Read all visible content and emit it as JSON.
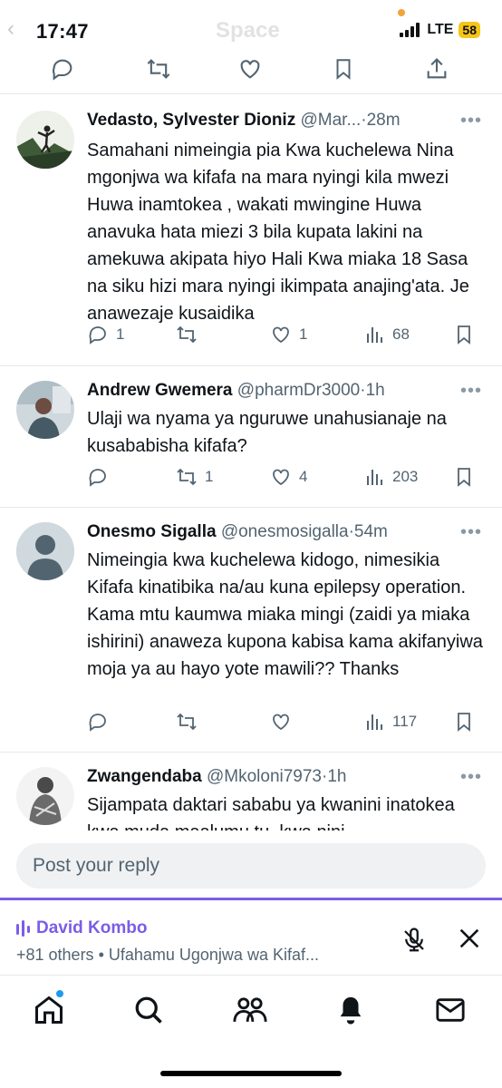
{
  "status_bar": {
    "time": "17:47",
    "carrier_type": "LTE",
    "battery": "58",
    "back_glyph": "‹",
    "ghost_title": "Space"
  },
  "top_actions": [
    "reply-icon",
    "retweet-icon",
    "like-icon",
    "bookmark-icon",
    "share-icon"
  ],
  "replies": [
    {
      "author": "Vedasto, Sylvester Dioniz",
      "handle": "@Mar...",
      "dot": "·",
      "ago": "28m",
      "more": "•••",
      "text": "Samahani nimeingia pia Kwa kuchelewa Nina mgonjwa wa kifafa na mara nyingi kila mwezi Huwa inamtokea , wakati mwingine Huwa anavuka hata miezi 3 bila kupata lakini na amekuwa akipata hiyo Hali Kwa miaka 18 Sasa na siku hizi mara nyingi ikimpata anajing'ata. Je anawezaje kusaidika",
      "replies": "1",
      "retweets": "",
      "likes": "1",
      "views": "68"
    },
    {
      "author": "Andrew Gwemera",
      "handle": "@pharmDr3000",
      "dot": "·",
      "ago": "1h",
      "more": "•••",
      "text": "Ulaji wa nyama ya nguruwe unahusianaje na kusababisha kifafa?",
      "replies": "",
      "retweets": "1",
      "likes": "4",
      "views": "203"
    },
    {
      "author": "Onesmo Sigalla",
      "handle": "@onesmosigalla",
      "dot": "·",
      "ago": "54m",
      "more": "•••",
      "text": "Nimeingia kwa kuchelewa kidogo, nimesikia Kifafa kinatibika na/au kuna epilepsy operation. Kama mtu kaumwa miaka mingi (zaidi ya miaka ishirini) anaweza kupona kabisa kama akifanyiwa moja ya au hayo yote mawili?? Thanks",
      "replies": "",
      "retweets": "",
      "likes": "",
      "views": "117"
    },
    {
      "author": "Zwangendaba",
      "handle": "@Mkoloni7973",
      "dot": "·",
      "ago": "1h",
      "more": "•••",
      "text": "Sijampata daktari sababu ya kwanini inatokea kwa muda maalumu tu, kwa nini"
    }
  ],
  "reply_input": {
    "placeholder": "Post your reply"
  },
  "space": {
    "host": "David Kombo",
    "subtitle": "+81 others • Ufahamu Ugonjwa wa Kifaf...",
    "accent": "#7c5ce6"
  },
  "bottom_nav": [
    "home-icon",
    "search-icon",
    "communities-icon",
    "notifications-icon",
    "messages-icon"
  ]
}
